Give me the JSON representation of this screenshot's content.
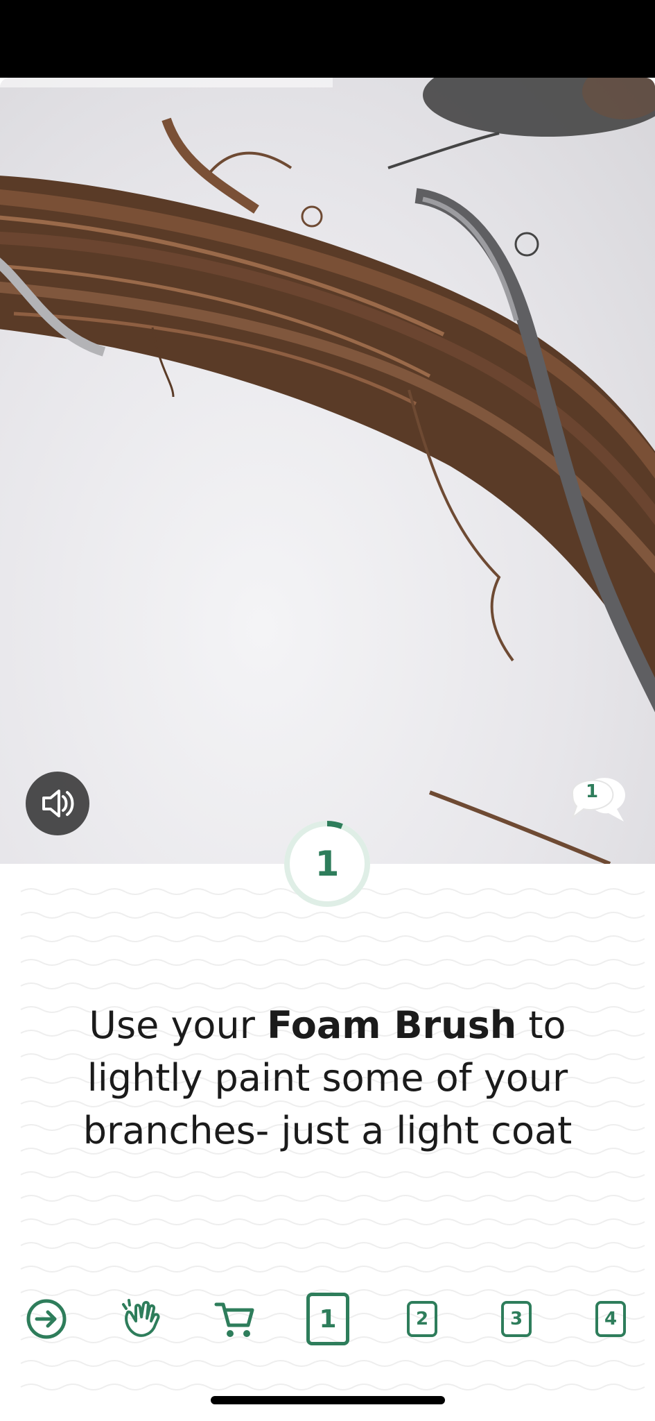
{
  "video": {
    "sound_icon": "speaker-with-mute-icon",
    "comments": {
      "icon": "speech-bubbles-icon",
      "count": "1"
    }
  },
  "step": {
    "current": "1",
    "progress_fraction": 0.06
  },
  "instruction": {
    "before": "Use your ",
    "bold": "Foam Brush",
    "after": " to lightly paint some of your branches- just a light coat"
  },
  "nav": {
    "items": [
      {
        "icon": "arrow-right-circle-icon"
      },
      {
        "icon": "clapping-hands-icon"
      },
      {
        "icon": "shopping-cart-icon"
      }
    ],
    "steps": [
      "1",
      "2",
      "3",
      "4"
    ],
    "active_step": "1"
  },
  "colors": {
    "accent": "#2e7d5b",
    "accent_light": "#dfeee6",
    "text": "#1b1b1b"
  }
}
